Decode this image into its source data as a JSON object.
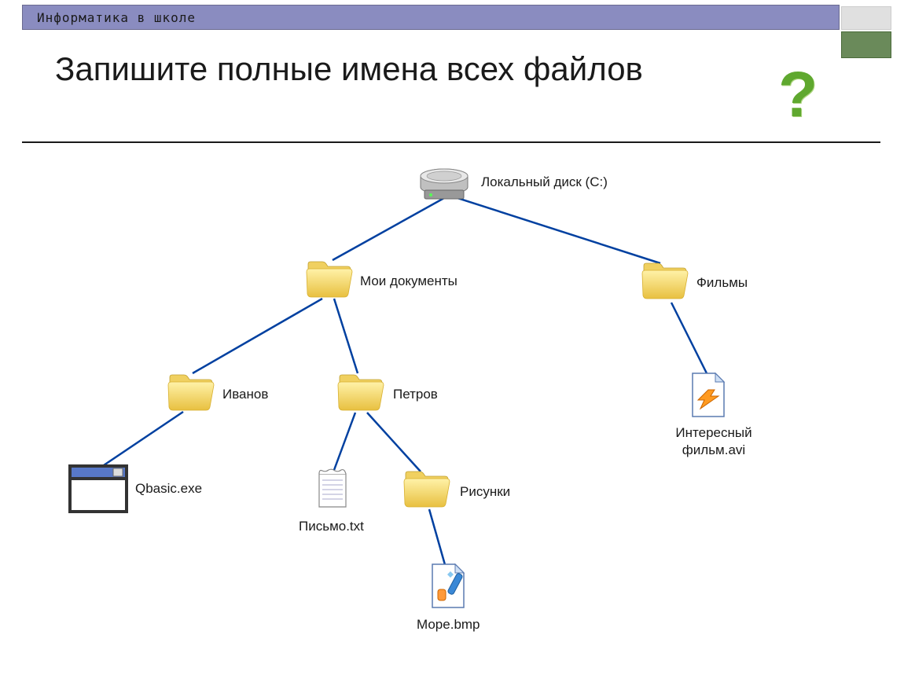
{
  "header": {
    "text": "Информатика в школе"
  },
  "title": {
    "text": "Запишите полные имена всех файлов"
  },
  "question_mark": "?",
  "nodes": {
    "disk": {
      "label": "Локальный диск (С:)"
    },
    "mydocs": {
      "label": "Мои документы"
    },
    "films": {
      "label": "Фильмы"
    },
    "ivanov": {
      "label": "Иванов"
    },
    "petrov": {
      "label": "Петров"
    },
    "qbasic": {
      "label": "Qbasic.exe"
    },
    "letter": {
      "label": "Письмо.txt"
    },
    "pictures": {
      "label": "Рисунки"
    },
    "sea": {
      "label": "Море.bmp"
    },
    "movie": {
      "label": "Интересный фильм.avi"
    }
  },
  "diagram_structure": {
    "root": "Локальный диск (С:)",
    "children": [
      {
        "name": "Мои документы",
        "type": "folder",
        "children": [
          {
            "name": "Иванов",
            "type": "folder",
            "children": [
              {
                "name": "Qbasic.exe",
                "type": "file"
              }
            ]
          },
          {
            "name": "Петров",
            "type": "folder",
            "children": [
              {
                "name": "Письмо.txt",
                "type": "file"
              },
              {
                "name": "Рисунки",
                "type": "folder",
                "children": [
                  {
                    "name": "Море.bmp",
                    "type": "file"
                  }
                ]
              }
            ]
          }
        ]
      },
      {
        "name": "Фильмы",
        "type": "folder",
        "children": [
          {
            "name": "Интересный фильм.avi",
            "type": "file"
          }
        ]
      }
    ]
  }
}
